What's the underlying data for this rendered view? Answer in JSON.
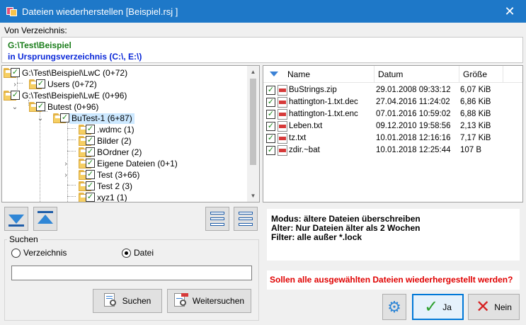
{
  "window": {
    "title": "Dateien wiederherstellen [Beispiel.rsj ]",
    "close_glyph": "✕"
  },
  "source": {
    "label": "Von Verzeichnis:",
    "path": "G:\\Test\\Beispiel",
    "origin": "in Ursprungsverzeichnis (C:\\, E:\\)"
  },
  "tree": {
    "nodes": [
      {
        "label": "G:\\Test\\Beispiel\\LwC (0+72)",
        "expander": ""
      },
      {
        "label": "Users (0+72)",
        "expander": "›"
      },
      {
        "label": "G:\\Test\\Beispiel\\LwE (0+96)",
        "expander": ""
      },
      {
        "label": "Butest (0+96)",
        "expander": "⌄"
      },
      {
        "label": "BuTest-1 (6+87)",
        "expander": "⌄",
        "selected": true
      },
      {
        "label": ".wdmc (1)",
        "expander": ""
      },
      {
        "label": "Bilder (2)",
        "expander": ""
      },
      {
        "label": "BOrdner (2)",
        "expander": ""
      },
      {
        "label": "Eigene Dateien (0+1)",
        "expander": "›"
      },
      {
        "label": "Test (3+66)",
        "expander": "›"
      },
      {
        "label": "Test 2 (3)",
        "expander": ""
      },
      {
        "label": "xyz1 (1)",
        "expander": ""
      }
    ],
    "check_glyph": "✓",
    "scroll_up_glyph": "▲",
    "scroll_down_glyph": "▼"
  },
  "files": {
    "columns": {
      "name": "Name",
      "date": "Datum",
      "size": "Größe"
    },
    "rows": [
      {
        "name": "BuStrings.zip",
        "date": "29.01.2008 09:33:12",
        "size": "6,07 KiB"
      },
      {
        "name": "hattington-1.txt.dec",
        "date": "27.04.2016 11:24:02",
        "size": "6,86 KiB"
      },
      {
        "name": "hattington-1.txt.enc",
        "date": "07.01.2016 10:59:02",
        "size": "6,88 KiB"
      },
      {
        "name": "Leben.txt",
        "date": "09.12.2010 19:58:56",
        "size": "2,13 KiB"
      },
      {
        "name": "tz.txt",
        "date": "10.01.2018 12:16:16",
        "size": "7,17 KiB"
      },
      {
        "name": "zdir.~bat",
        "date": "10.01.2018 12:25:44",
        "size": "107 B"
      }
    ]
  },
  "search": {
    "title": "Suchen",
    "opt_dir": "Verzeichnis",
    "opt_file": "Datei",
    "selected": "Datei",
    "input_value": "",
    "search_btn": "Suchen",
    "next_btn": "Weitersuchen"
  },
  "info": {
    "mode": "Modus: ältere Dateien überschreiben",
    "age": "Alter: Nur Dateien älter als 2 Wochen",
    "filter": "Filter: alle außer *.lock"
  },
  "question": "Sollen alle ausgewählten Dateien wiederhergestellt werden?",
  "buttons": {
    "settings_glyph": "⚙",
    "yes": "Ja",
    "no": "Nein",
    "yes_glyph": "✓",
    "no_glyph": "✕"
  },
  "colors": {
    "title_bar": "#1e78c8",
    "path_green": "#1a7d1a",
    "path_blue": "#0a28d8",
    "question_red": "#e00000",
    "accent": "#2f86d6"
  }
}
